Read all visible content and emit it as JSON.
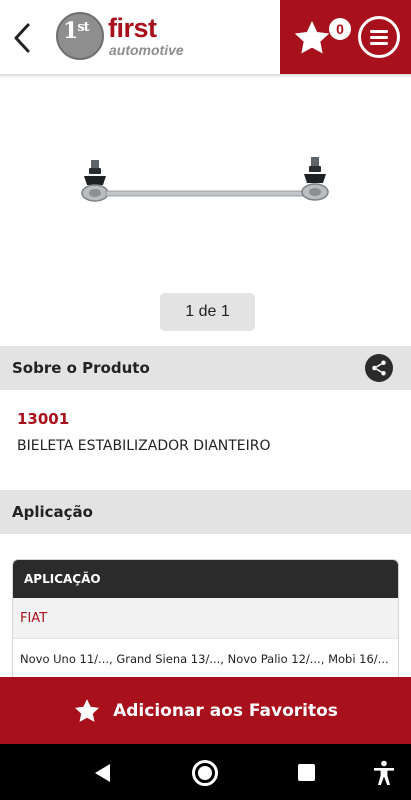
{
  "header": {
    "back_icon": "chevron-left-icon",
    "logo": {
      "mark": "1",
      "mark_sup": "st",
      "brand": "first",
      "tagline": "automotive"
    },
    "favorites": {
      "icon": "star-icon",
      "count": "0"
    },
    "menu_icon": "hamburger-menu-icon",
    "accent_color": "#a8101b"
  },
  "gallery": {
    "image_alt": "stabilizer-link-bar-image",
    "pager_text": "1 de 1"
  },
  "about": {
    "title": "Sobre o Produto",
    "share_icon": "share-icon",
    "code": "13001",
    "name": "BIELETA ESTABILIZADOR DIANTEIRO"
  },
  "application": {
    "title": "Aplicação",
    "table_header": "APLICAÇÃO",
    "brand": "FIAT",
    "models": "Novo Uno 11/..., Grand Siena 13/..., Novo Palio 12/..., Mobi 16/..."
  },
  "actions": {
    "add_favorites_label": "Adicionar aos Favoritos",
    "add_favorites_icon": "star-icon"
  },
  "system_nav": {
    "back_icon": "nav-back-icon",
    "home_icon": "nav-home-icon",
    "recents_icon": "nav-recents-icon",
    "accessibility_icon": "accessibility-icon"
  }
}
